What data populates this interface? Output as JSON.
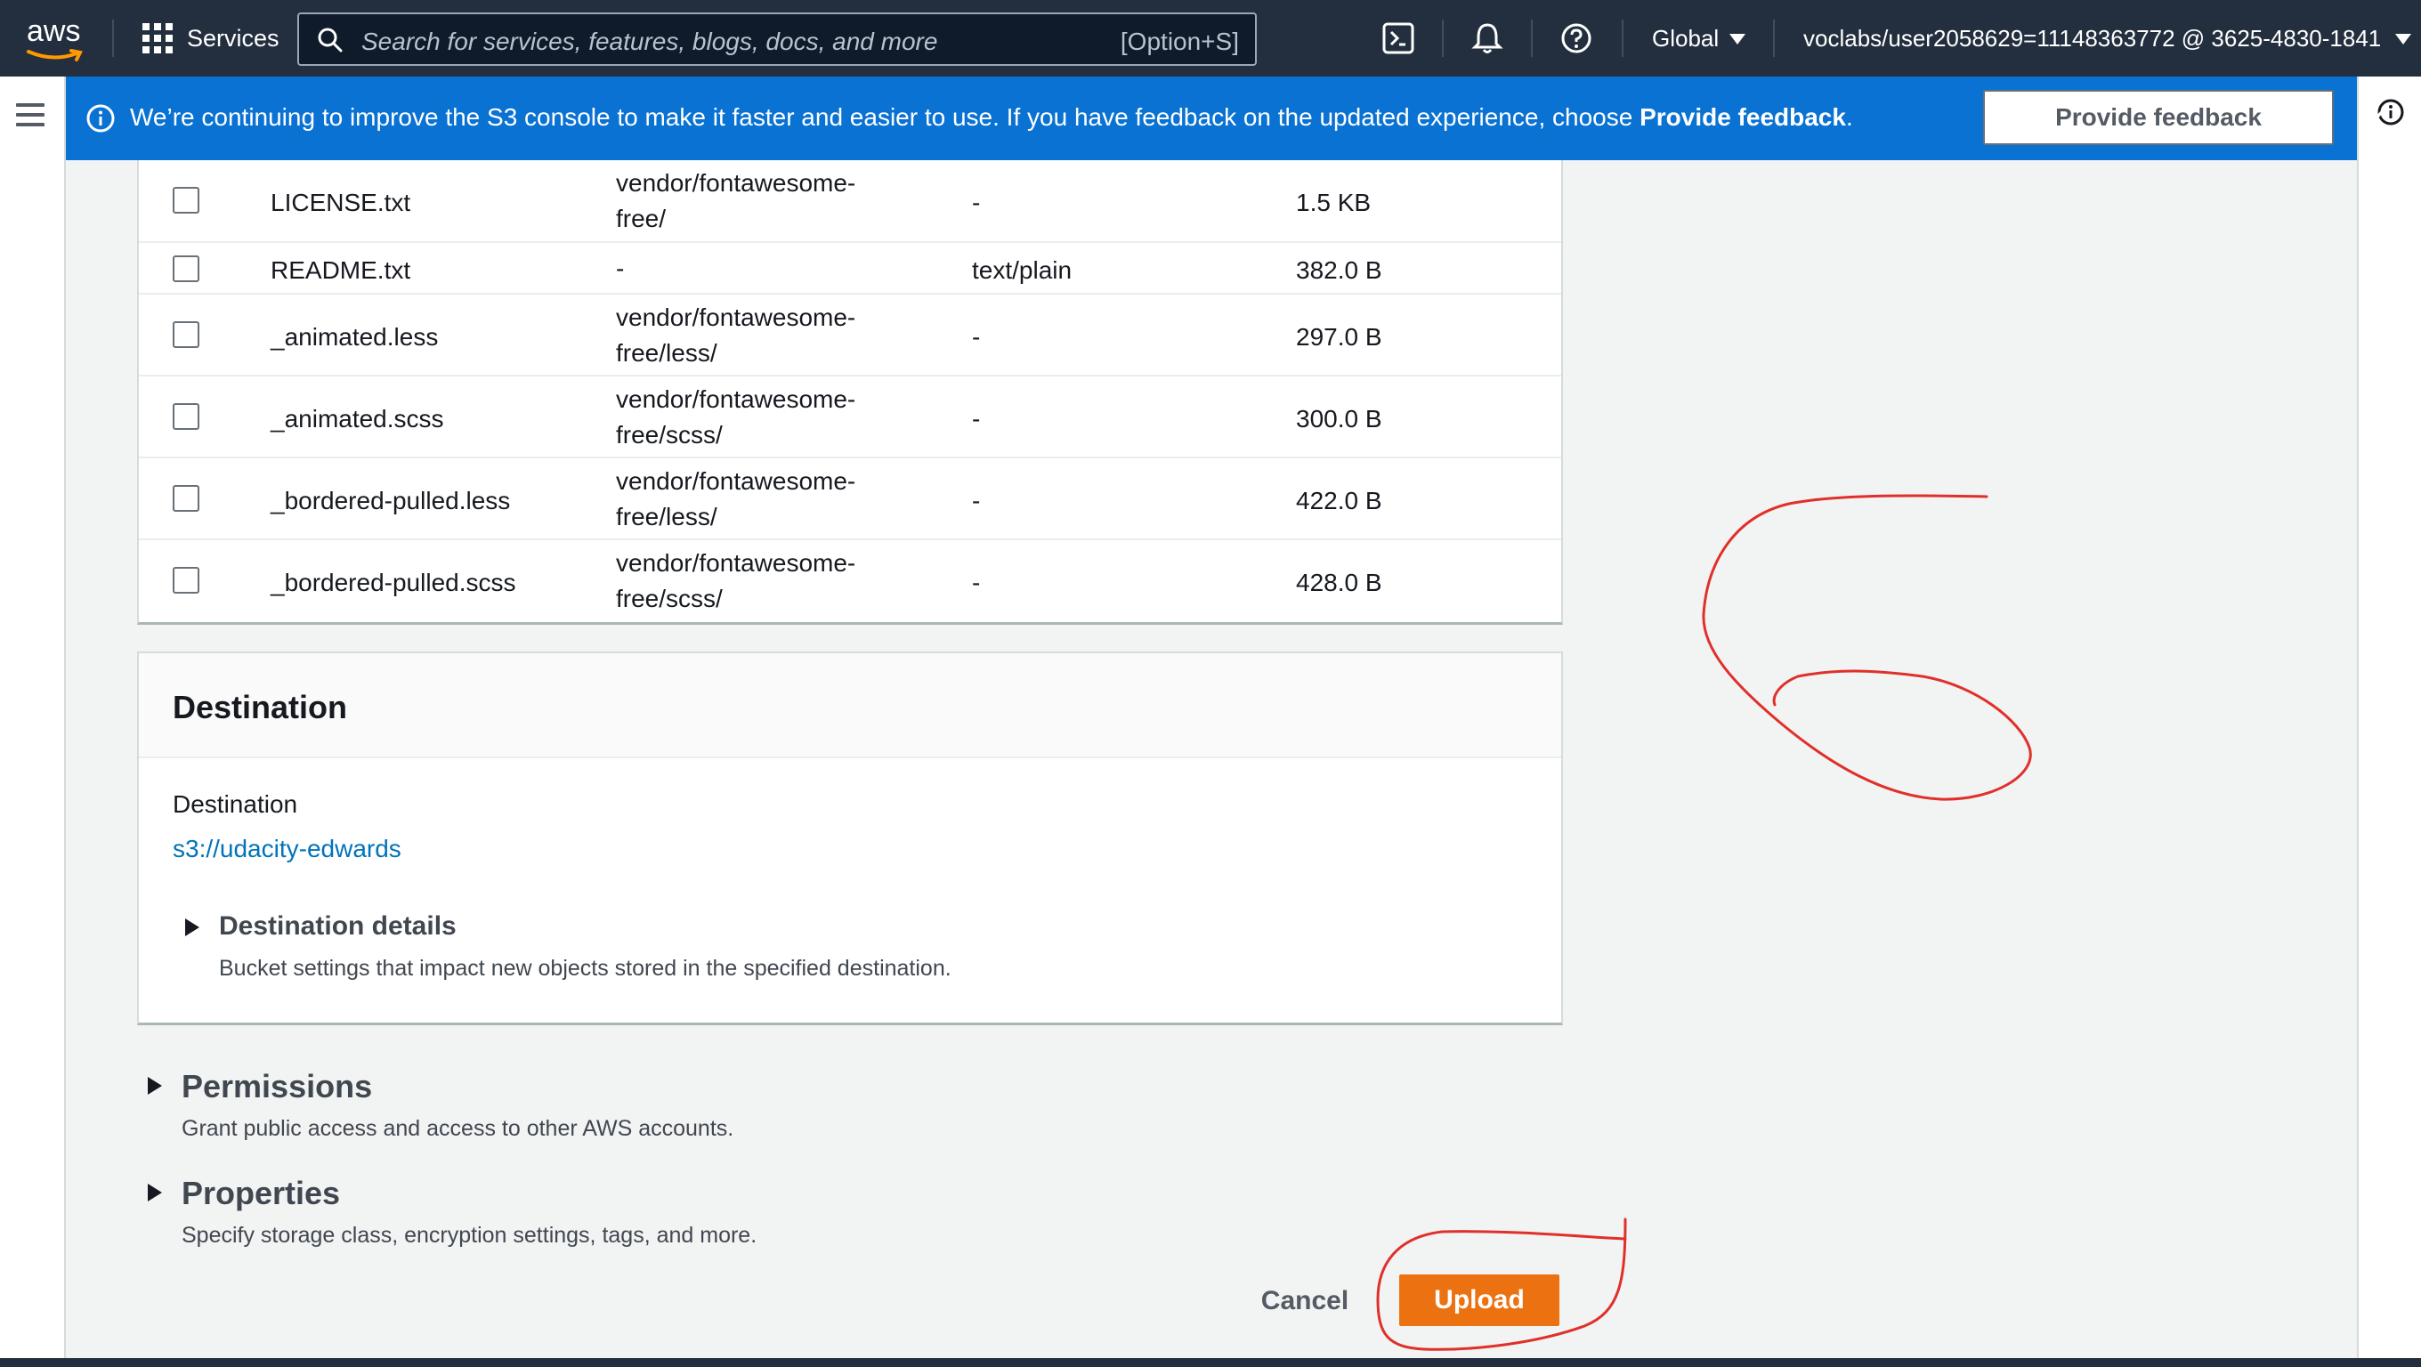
{
  "topnav": {
    "logo": "aws",
    "services_label": "Services",
    "search_placeholder": "Search for services, features, blogs, docs, and more",
    "search_shortcut": "[Option+S]",
    "region": "Global",
    "account": "voclabs/user2058629=11148363772 @ 3625-4830-1841",
    "icons": [
      "cloudshell-icon",
      "bell-icon",
      "help-icon"
    ]
  },
  "flash": {
    "text": "We’re continuing to improve the S3 console to make it faster and easier to use. If you have feedback on the updated experience, choose ",
    "text_bold": "Provide feedback",
    "text_end": ".",
    "button": "Provide feedback"
  },
  "files": [
    {
      "name": "LICENSE.txt",
      "folder_line1": "vendor/fontawesome-",
      "folder_line2": "free/",
      "type": "-",
      "size": "1.5 KB"
    },
    {
      "name": "README.txt",
      "folder_line1": "-",
      "folder_line2": "",
      "type": "text/plain",
      "size": "382.0 B"
    },
    {
      "name": "_animated.less",
      "folder_line1": "vendor/fontawesome-",
      "folder_line2": "free/less/",
      "type": "-",
      "size": "297.0 B"
    },
    {
      "name": "_animated.scss",
      "folder_line1": "vendor/fontawesome-",
      "folder_line2": "free/scss/",
      "type": "-",
      "size": "300.0 B"
    },
    {
      "name": "_bordered-pulled.less",
      "folder_line1": "vendor/fontawesome-",
      "folder_line2": "free/less/",
      "type": "-",
      "size": "422.0 B"
    },
    {
      "name": "_bordered-pulled.scss",
      "folder_line1": "vendor/fontawesome-",
      "folder_line2": "free/scss/",
      "type": "-",
      "size": "428.0 B"
    }
  ],
  "destination": {
    "title": "Destination",
    "label": "Destination",
    "link": "s3://udacity-edwards",
    "details_title": "Destination details",
    "details_desc": "Bucket settings that impact new objects stored in the specified destination."
  },
  "permissions": {
    "title": "Permissions",
    "desc": "Grant public access and access to other AWS accounts."
  },
  "properties": {
    "title": "Properties",
    "desc": "Specify storage class, encryption settings, tags, and more."
  },
  "actions": {
    "cancel": "Cancel",
    "upload": "Upload"
  },
  "colors": {
    "nav_bg": "#232f3e",
    "flash_bg": "#0972d3",
    "primary_button": "#ec7211",
    "link": "#0073bb",
    "annotation": "#e0302a"
  }
}
